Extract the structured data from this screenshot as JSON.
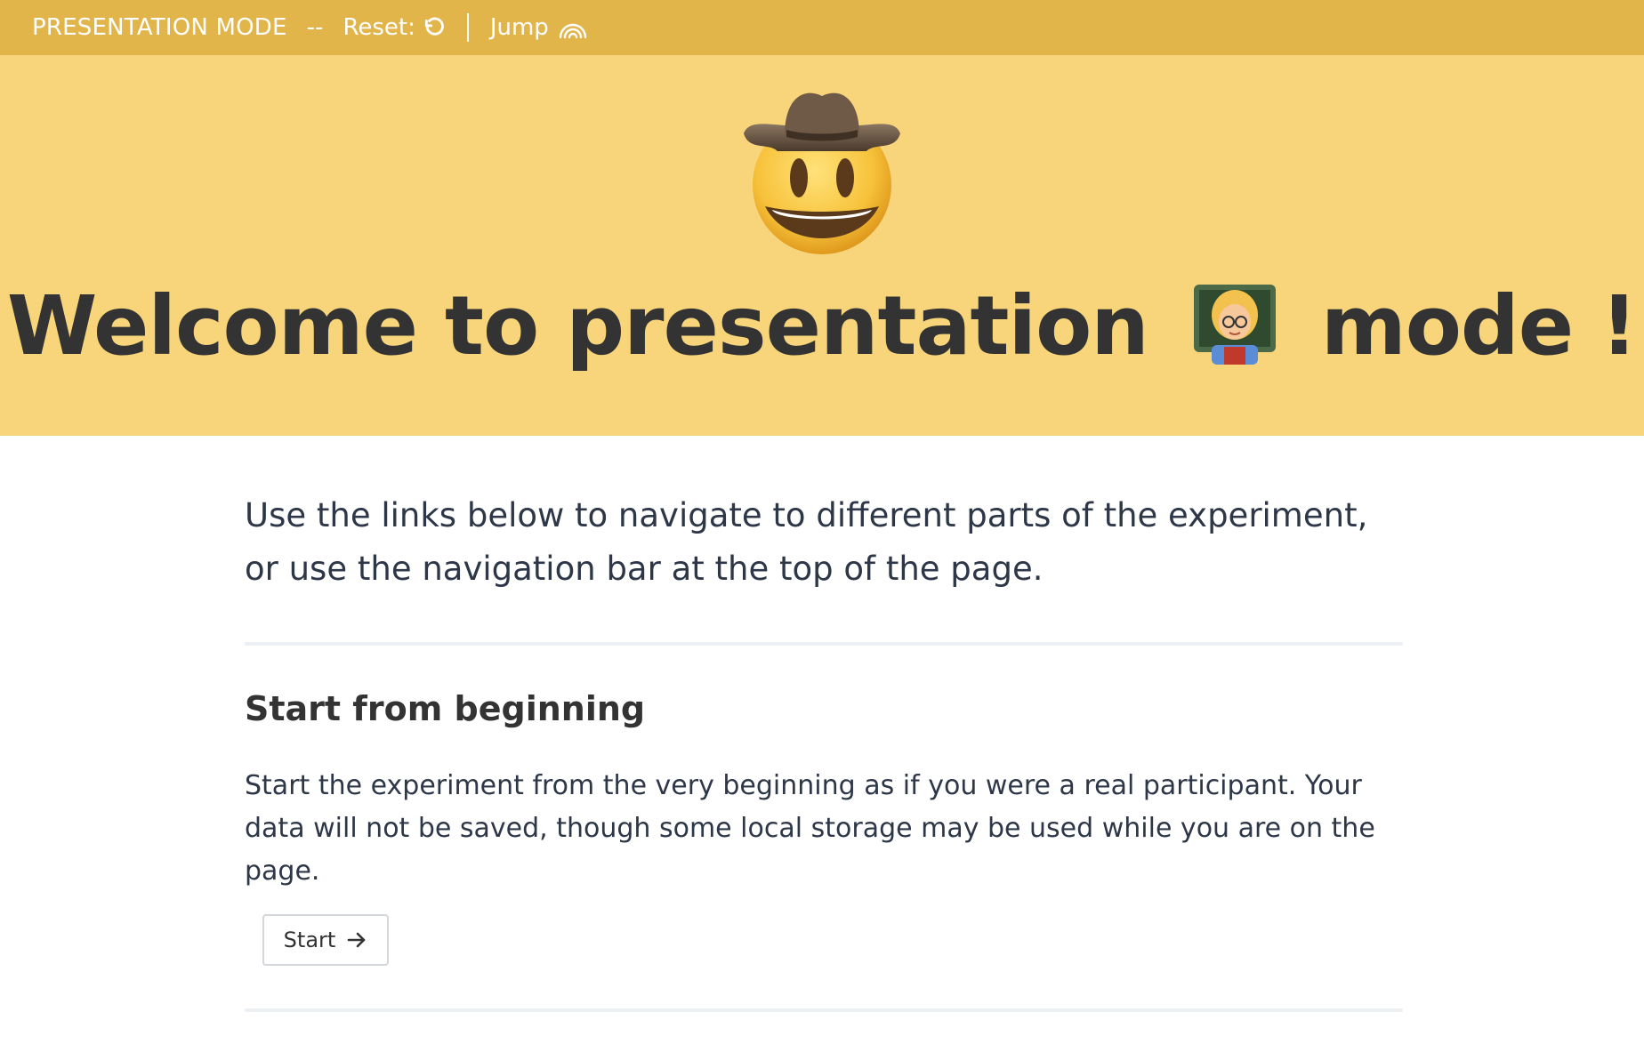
{
  "topbar": {
    "mode_label": "PRESENTATION MODE",
    "separator": "--",
    "reset_label": "Reset:",
    "reset_icon": "rotate-ccw-icon",
    "jump_label": "Jump",
    "jump_icon": "rainbow-icon",
    "background": "#e2b54b"
  },
  "hero": {
    "emoji_icon": "cowboy-hat-face-emoji",
    "title_before": "Welcome to presentation",
    "title_emoji_icon": "woman-teacher-emoji",
    "title_after": "mode !",
    "background": "#f8d57a"
  },
  "intro": {
    "text": "Use the links below to navigate to different parts of the experiment, or use the navigation bar at the top of the page."
  },
  "sections": [
    {
      "title": "Start from beginning",
      "description": "Start the experiment from the very beginning as if you were a real participant. Your data will not be saved, though some local storage may be used while you are on the page.",
      "button_label": "Start",
      "button_icon": "arrow-right-icon"
    }
  ]
}
